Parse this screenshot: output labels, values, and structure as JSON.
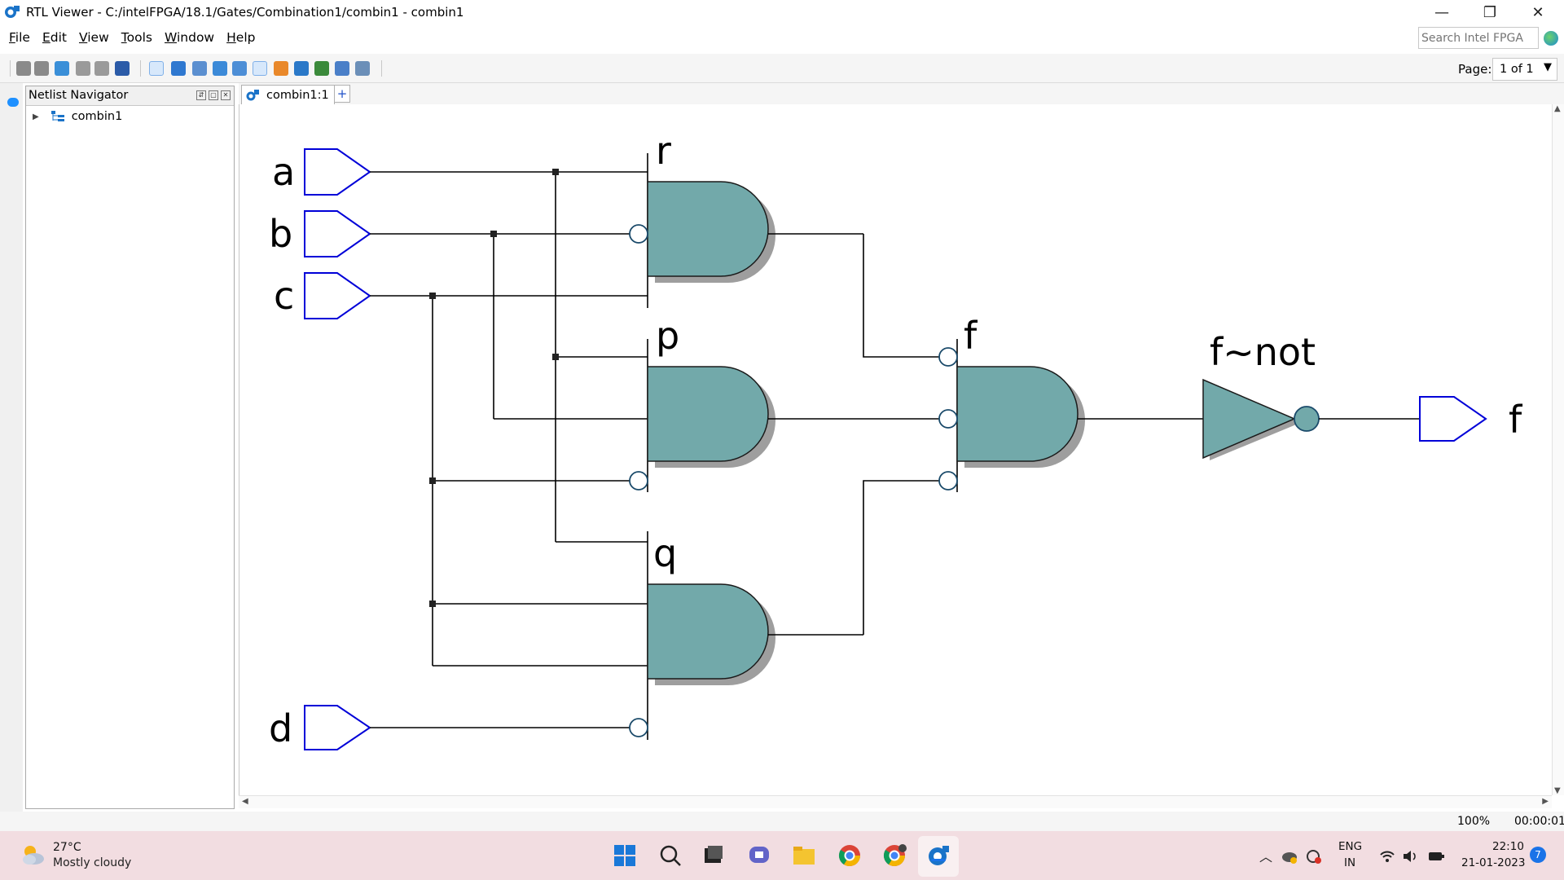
{
  "window": {
    "title": "RTL Viewer - C:/intelFPGA/18.1/Gates/Combination1/combin1 - combin1",
    "minimize_glyph": "—",
    "restore_glyph": "❐",
    "close_glyph": "✕"
  },
  "menu": [
    "File",
    "Edit",
    "View",
    "Tools",
    "Window",
    "Help"
  ],
  "search": {
    "placeholder": "Search Intel FPGA"
  },
  "toolbar": {
    "icons": [
      "back-icon",
      "forward-icon",
      "refresh-icon",
      "collapse-icon",
      "expand-icon",
      "find-icon",
      "select-icon",
      "zoom-icon",
      "fit-icon",
      "hand-icon",
      "bus-icon",
      "hierarchy-icon",
      "color-icon",
      "settings-icon",
      "filter-icon",
      "export-icon",
      "page-icon"
    ],
    "page_label": "Page:",
    "page_value": "1 of 1"
  },
  "navigator": {
    "title": "Netlist Navigator",
    "tree": [
      {
        "label": "combin1",
        "expanded": false
      }
    ]
  },
  "tab": {
    "label": "combin1:1",
    "add": "+"
  },
  "schematic": {
    "inputs": [
      "a",
      "b",
      "c",
      "d"
    ],
    "output": "f",
    "gates": {
      "r": "r",
      "p": "p",
      "q": "q",
      "f": "f",
      "not": "f~not"
    },
    "colors": {
      "gate_fill": "#72a9aa",
      "gate_shadow": "#9e9e9e",
      "port_stroke": "#0000d8",
      "wire": "#000000"
    }
  },
  "status": {
    "zoom": "100%",
    "elapsed": "00:00:01"
  },
  "taskbar": {
    "weather_temp": "27°C",
    "weather_desc": "Mostly cloudy",
    "lang_top": "ENG",
    "lang_bottom": "IN",
    "time": "22:10",
    "date": "21-01-2023",
    "notifications": "7",
    "apps": [
      "start-icon",
      "search-icon",
      "task-view-icon",
      "teams-icon",
      "file-explorer-icon",
      "chrome-icon",
      "chrome-profile-icon",
      "quartus-rtl-icon"
    ]
  }
}
